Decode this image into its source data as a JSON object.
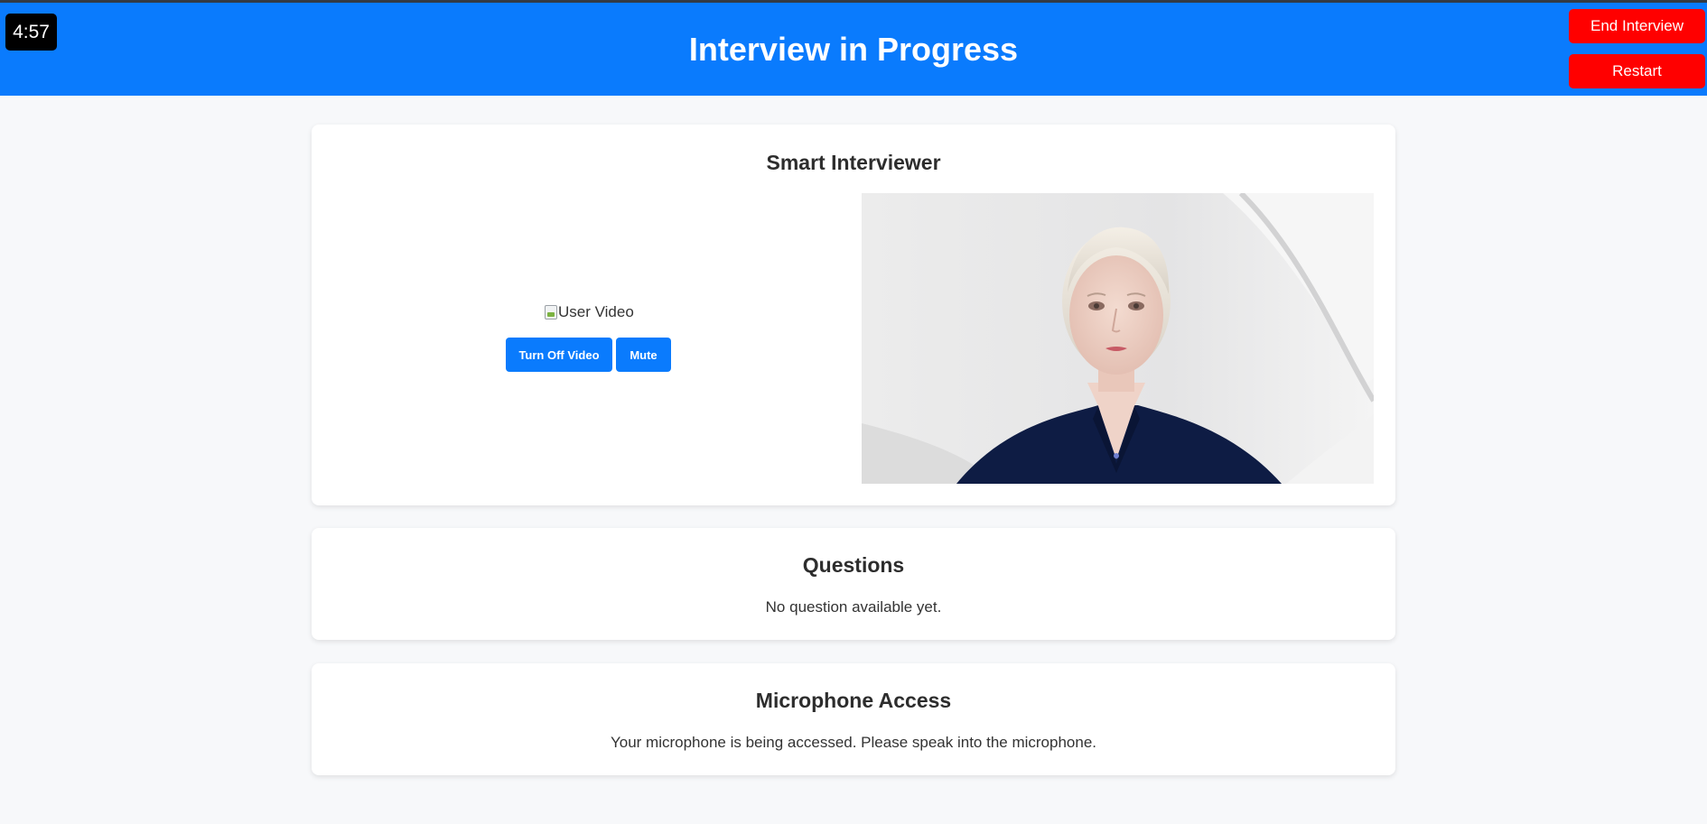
{
  "header": {
    "timer": "4:57",
    "title": "Interview in Progress",
    "end_label": "End Interview",
    "restart_label": "Restart",
    "bg_color": "#0a7bfd",
    "danger_color": "#ff0000"
  },
  "interviewer": {
    "title": "Smart Interviewer",
    "user_video_alt": "User Video",
    "video_button": "Turn Off Video",
    "mute_button": "Mute",
    "avatar_icon": "ai-avatar-video"
  },
  "questions": {
    "title": "Questions",
    "text": "No question available yet."
  },
  "microphone": {
    "title": "Microphone Access",
    "text": "Your microphone is being accessed. Please speak into the microphone."
  }
}
